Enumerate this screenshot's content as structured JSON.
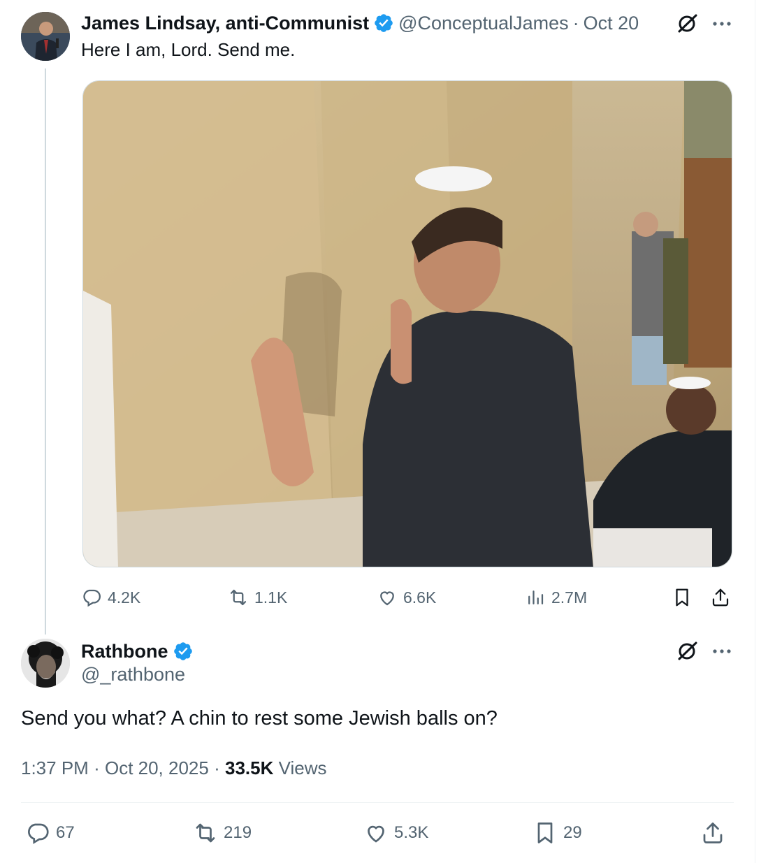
{
  "parent": {
    "author_name": "James Lindsay, anti-Communist",
    "handle": "@ConceptualJames",
    "separator": "·",
    "date": "Oct 20",
    "text": "Here I am, Lord. Send me.",
    "stats": {
      "replies": "4.2K",
      "reposts": "1.1K",
      "likes": "6.6K",
      "views": "2.7M"
    }
  },
  "reply": {
    "author_name": "Rathbone",
    "handle": "@_rathbone",
    "text": "Send you what? A chin to rest some Jewish balls on?",
    "time": "1:37 PM",
    "separator": "·",
    "date": "Oct 20, 2025",
    "views_count": "33.5K",
    "views_label": "Views",
    "stats": {
      "replies": "67",
      "reposts": "219",
      "likes": "5.3K",
      "bookmarks": "29"
    }
  },
  "icons": {
    "verified": "verified-badge-icon",
    "grok": "grok-icon",
    "more": "more-dots-icon",
    "reply": "reply-icon",
    "repost": "repost-icon",
    "like": "heart-icon",
    "views": "views-chart-icon",
    "bookmark": "bookmark-icon",
    "share": "share-icon"
  },
  "colors": {
    "text_primary": "#0f1419",
    "text_secondary": "#536471",
    "verified_blue": "#1d9bf0",
    "thread_line": "#cfd9de"
  }
}
